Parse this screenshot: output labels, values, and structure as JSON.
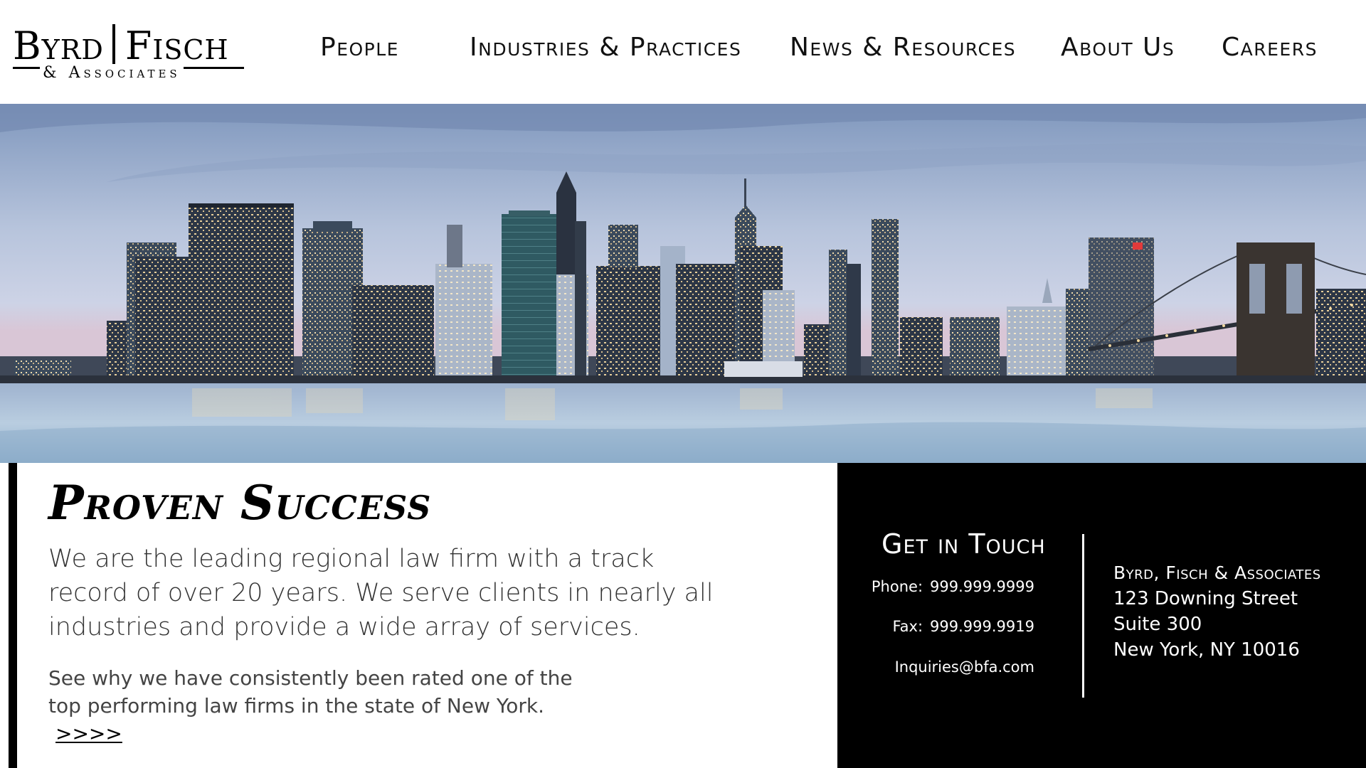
{
  "brand": {
    "name_left": "Byrd",
    "name_right": "Fisch",
    "tagline": "& Associates"
  },
  "nav": {
    "items": [
      {
        "label": "People"
      },
      {
        "label": "Industries & Practices"
      },
      {
        "label": "News & Resources"
      },
      {
        "label": "About Us"
      },
      {
        "label": "Careers"
      }
    ]
  },
  "hero": {
    "image": "new-york-skyline-brooklyn-bridge"
  },
  "main": {
    "headline": "Proven Success",
    "lead": "We are the leading regional law firm with a track record of over 20 years. We serve clients in nearly all industries and provide a wide array of services.",
    "sub": "See why we have consistently been rated one of the top performing law firms in the state of New York.",
    "more_link": ">>>>"
  },
  "contact": {
    "title": "Get in Touch",
    "phone_label": "Phone:",
    "phone": "999.999.9999",
    "fax_label": "Fax:",
    "fax": "999.999.9919",
    "email": "Inquiries@bfa.com",
    "address": {
      "firm": "Byrd, Fisch & Associates",
      "street": "123 Downing Street",
      "suite": "Suite 300",
      "city": "New York, NY 10016"
    }
  },
  "colors": {
    "background": "#ffffff",
    "panel": "#000000",
    "text": "#111111"
  }
}
